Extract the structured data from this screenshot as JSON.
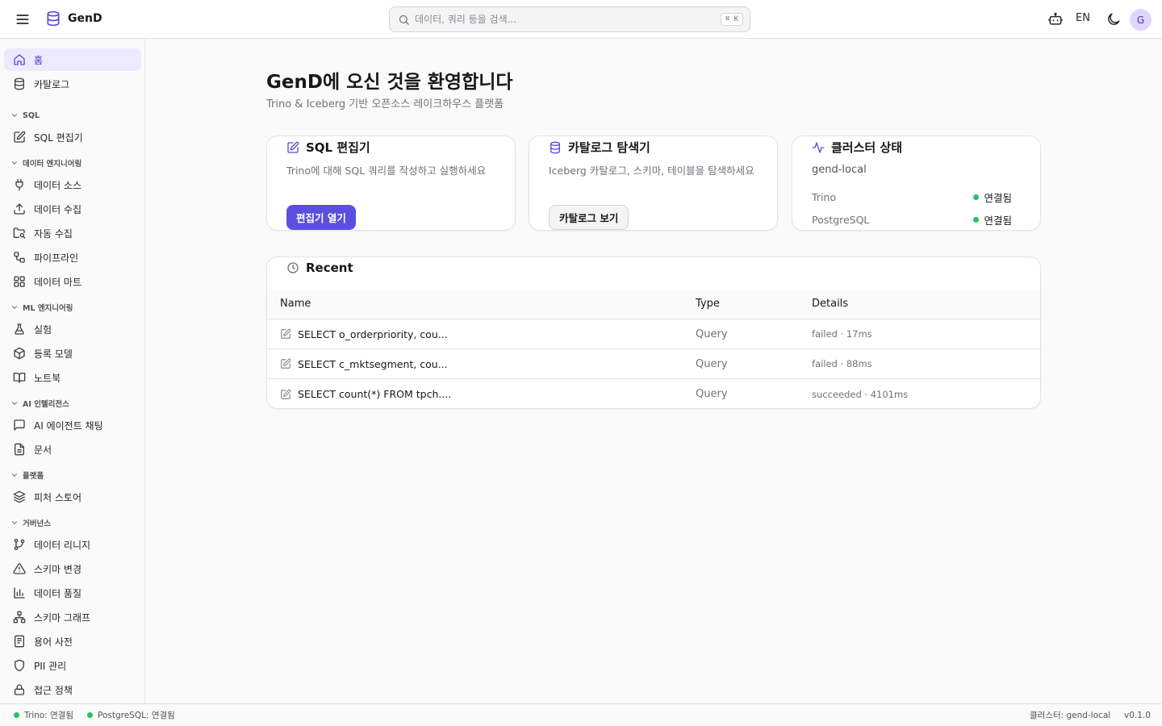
{
  "app": {
    "name": "GenD"
  },
  "header": {
    "search_placeholder": "데이터, 쿼리 등을 검색...",
    "search_shortcut": "⌘ K",
    "language": "EN",
    "avatar_initial": "G"
  },
  "sidebar": {
    "top_items": [
      {
        "label": "홈",
        "icon": "home-icon",
        "active": true
      },
      {
        "label": "카탈로그",
        "icon": "database-icon"
      }
    ],
    "sections": [
      {
        "label": "SQL",
        "items": [
          {
            "label": "SQL 편집기",
            "icon": "edit-icon"
          }
        ]
      },
      {
        "label": "데이터 엔지니어링",
        "items": [
          {
            "label": "데이터 소스",
            "icon": "plug-icon"
          },
          {
            "label": "데이터 수집",
            "icon": "upload-icon"
          },
          {
            "label": "자동 수집",
            "icon": "folder-search-icon"
          },
          {
            "label": "파이프라인",
            "icon": "workflow-icon"
          },
          {
            "label": "데이터 마트",
            "icon": "grid-icon"
          }
        ]
      },
      {
        "label": "ML 엔지니어링",
        "items": [
          {
            "label": "실험",
            "icon": "flask-icon"
          },
          {
            "label": "등록 모델",
            "icon": "package-icon"
          },
          {
            "label": "노트북",
            "icon": "book-icon"
          }
        ]
      },
      {
        "label": "AI 인텔리전스",
        "items": [
          {
            "label": "AI 에이전트 채팅",
            "icon": "chat-icon"
          },
          {
            "label": "문서",
            "icon": "document-icon"
          }
        ]
      },
      {
        "label": "플랫폼",
        "items": [
          {
            "label": "피처 스토어",
            "icon": "layers-icon"
          }
        ]
      },
      {
        "label": "거버넌스",
        "items": [
          {
            "label": "데이터 리니지",
            "icon": "git-branch-icon"
          },
          {
            "label": "스키마 변경",
            "icon": "warning-icon"
          },
          {
            "label": "데이터 품질",
            "icon": "bar-chart-icon"
          },
          {
            "label": "스키마 그래프",
            "icon": "network-icon"
          },
          {
            "label": "용어 사전",
            "icon": "glossary-icon"
          },
          {
            "label": "PII 관리",
            "icon": "shield-icon"
          },
          {
            "label": "접근 정책",
            "icon": "lock-icon"
          }
        ]
      }
    ]
  },
  "main": {
    "title": "GenD에 오신 것을 환영합니다",
    "subtitle": "Trino & Iceberg 기반 오픈소스 레이크하우스 플랫폼",
    "cards": {
      "sql": {
        "title": "SQL 편집기",
        "desc": "Trino에 대해 SQL 쿼리를 작성하고 실행하세요",
        "button": "편집기 열기"
      },
      "catalog": {
        "title": "카탈로그 탐색기",
        "desc": "Iceberg 카탈로그, 스키마, 테이블을 탐색하세요",
        "button": "카탈로그 보기"
      },
      "cluster": {
        "title": "클러스터 상태",
        "name": "gend-local",
        "services": [
          {
            "name": "Trino",
            "status": "연결됨"
          },
          {
            "name": "PostgreSQL",
            "status": "연결됨"
          }
        ]
      }
    },
    "recent": {
      "title": "Recent",
      "columns": [
        "Name",
        "Type",
        "Details"
      ],
      "rows": [
        {
          "name": "SELECT o_orderpriority, cou...",
          "type": "Query",
          "details": "failed · 17ms"
        },
        {
          "name": "SELECT c_mktsegment, cou...",
          "type": "Query",
          "details": "failed · 88ms"
        },
        {
          "name": "SELECT count(*) FROM tpch....",
          "type": "Query",
          "details": "succeeded · 4101ms"
        }
      ]
    }
  },
  "footer": {
    "trino": "Trino: 연결됨",
    "postgres": "PostgreSQL: 연결됨",
    "cluster": "클러스터: gend-local",
    "version": "v0.1.0"
  },
  "colors": {
    "accent": "#5b4fe0",
    "active_bg": "#ede9fe",
    "status_ok": "#22c55e"
  }
}
